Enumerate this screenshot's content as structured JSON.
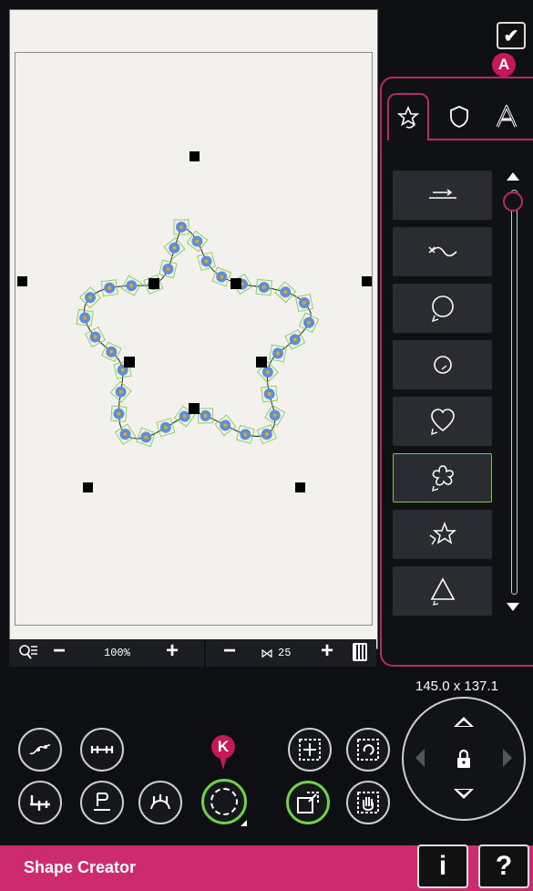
{
  "toolbar": {
    "zoom_value": "100%",
    "minus_label": "−",
    "plus_label": "+",
    "repeat_count": "25",
    "dimensions": "145.0 x 137.1"
  },
  "tabs": [
    {
      "name": "shape-tab",
      "icon": "star-rotate-icon",
      "active": true
    },
    {
      "name": "shield-tab",
      "icon": "shield-icon",
      "active": false
    },
    {
      "name": "text-tab",
      "icon": "letter-a-icon",
      "active": false
    }
  ],
  "callouts": {
    "a": "A",
    "k": "K"
  },
  "shape_list": [
    {
      "icon": "line-icon"
    },
    {
      "icon": "wave-icon"
    },
    {
      "icon": "circle-icon"
    },
    {
      "icon": "small-circle-icon"
    },
    {
      "icon": "heart-icon"
    },
    {
      "icon": "flower-icon",
      "selected": true
    },
    {
      "icon": "star-icon"
    },
    {
      "icon": "triangle-icon"
    }
  ],
  "footer": {
    "title": "Shape Creator",
    "info_label": "i",
    "help_label": "?"
  },
  "colors": {
    "accent": "#cc2b6d",
    "selection": "#6fd24a"
  }
}
